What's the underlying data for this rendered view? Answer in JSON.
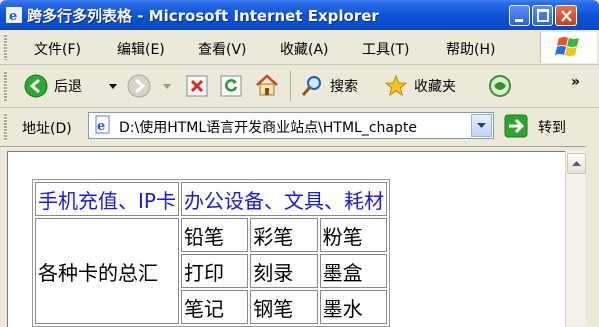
{
  "window": {
    "title": "跨多行多列表格 - Microsoft Internet Explorer"
  },
  "menu": [
    {
      "label": "文件(F)"
    },
    {
      "label": "编辑(E)"
    },
    {
      "label": "查看(V)"
    },
    {
      "label": "收藏(A)"
    },
    {
      "label": "工具(T)"
    },
    {
      "label": "帮助(H)"
    }
  ],
  "toolbar": {
    "back_label": "后退",
    "search_label": "搜索",
    "favorites_label": "收藏夹",
    "overflow": "»"
  },
  "address": {
    "label": "地址(D)",
    "value": "D:\\使用HTML语言开发商业站点\\HTML_chapte",
    "go_label": "转到"
  },
  "page": {
    "table": {
      "header_left": "手机充值、IP卡",
      "header_right": "办公设备、文具、耗材",
      "merged_cell": "各种卡的总汇",
      "rows": [
        [
          "铅笔",
          "彩笔",
          "粉笔"
        ],
        [
          "打印",
          "刻录",
          "墨盒"
        ],
        [
          "笔记",
          "钢笔",
          "墨水"
        ]
      ]
    }
  },
  "colors": {
    "titlebar": "#0a49c4",
    "header_text": "#1a1ad9"
  }
}
